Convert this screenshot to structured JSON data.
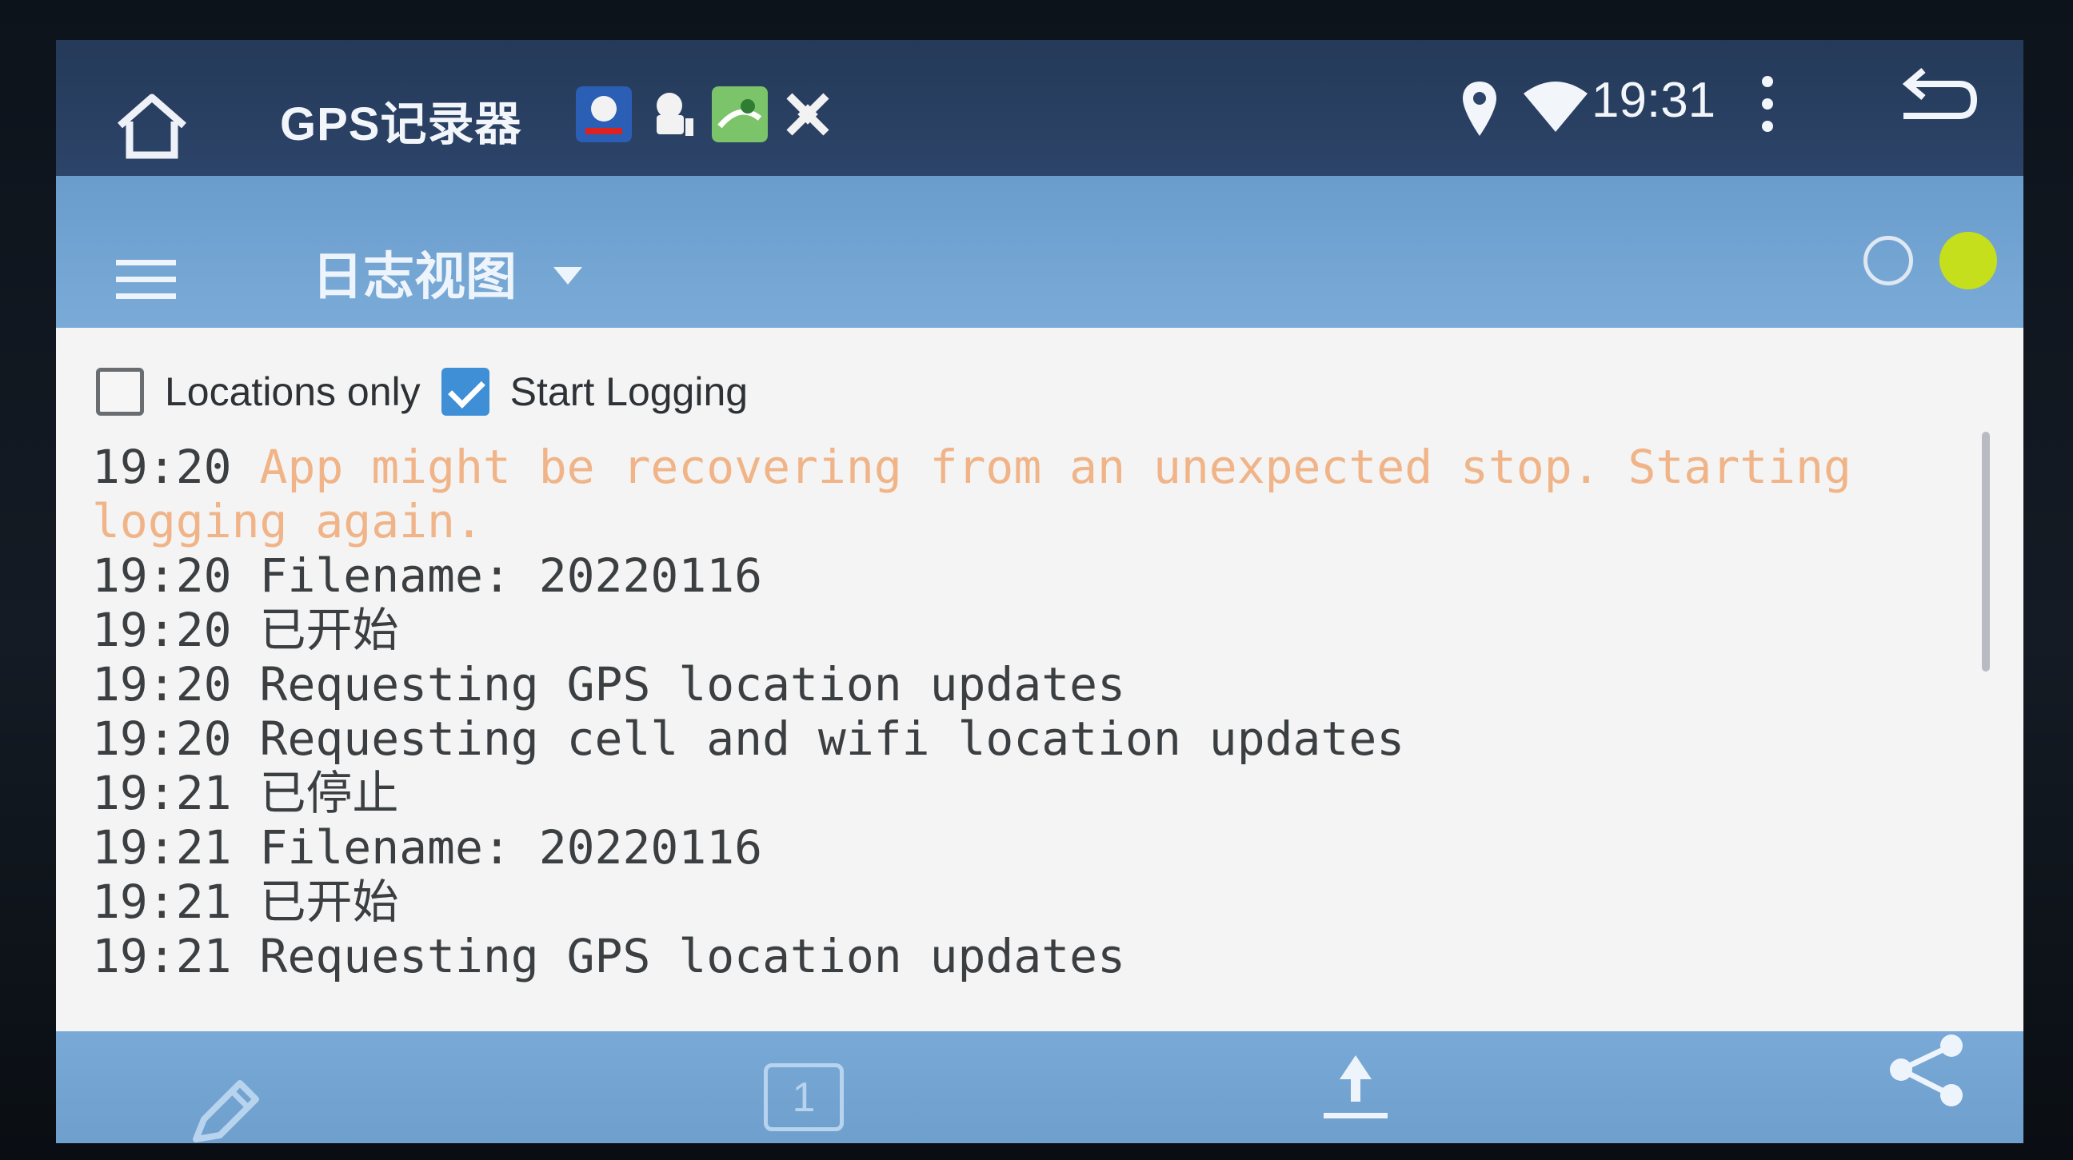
{
  "statusbar": {
    "app_title": "GPS记录器",
    "time": "19:31",
    "notification_icons": [
      "weather-icon",
      "android-icon",
      "map-icon",
      "satellite-icon"
    ]
  },
  "toolbar": {
    "view_title": "日志视图"
  },
  "options": {
    "locations_only_label": "Locations only",
    "locations_only_checked": false,
    "start_logging_label": "Start Logging",
    "start_logging_checked": true
  },
  "log": [
    {
      "time": "19:20",
      "message": "App might be recovering from an unexpected stop. Starting logging again.",
      "level": "warn"
    },
    {
      "time": "19:20",
      "message": "Filename: 20220116",
      "level": "info"
    },
    {
      "time": "19:20",
      "message": "已开始",
      "level": "info"
    },
    {
      "time": "19:20",
      "message": "Requesting GPS location updates",
      "level": "info"
    },
    {
      "time": "19:20",
      "message": "Requesting cell and wifi location updates",
      "level": "info"
    },
    {
      "time": "19:21",
      "message": "已停止",
      "level": "info"
    },
    {
      "time": "19:21",
      "message": "Filename: 20220116",
      "level": "info"
    },
    {
      "time": "19:21",
      "message": "已开始",
      "level": "info"
    },
    {
      "time": "19:21",
      "message": "Requesting GPS location updates",
      "level": "info"
    }
  ],
  "bottombar": {
    "page_number": "1"
  },
  "colors": {
    "statusbar": "#2c4469",
    "toolbar": "#7aabd8",
    "accent_dot": "#c6df1c",
    "warn_text": "#f0b488",
    "checkbox": "#3f8fd6"
  }
}
